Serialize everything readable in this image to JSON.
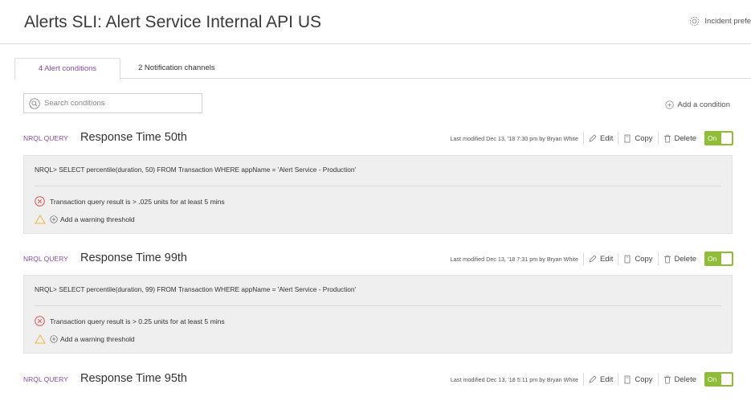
{
  "page": {
    "title": "Alerts SLI: Alert Service Internal API US",
    "incident_prefs": "Incident prefe"
  },
  "tabs": [
    {
      "label": "4 Alert conditions",
      "active": true
    },
    {
      "label": "2 Notification channels",
      "active": false
    }
  ],
  "search": {
    "placeholder": "Search conditions"
  },
  "add_condition": "Add a condition",
  "colors": {
    "accent": "#8a4b9f",
    "toggle_on": "#8fbd36",
    "critical": "#e05252",
    "warning": "#f0b43c"
  },
  "conditions": [
    {
      "tag": "NRQL QUERY",
      "name": "Response Time 50th",
      "modified": "Last modified Dec 13, '18 7:30 pm by Bryan White",
      "edit": "Edit",
      "copy": "Copy",
      "delete": "Delete",
      "toggle": "On",
      "query": "NRQL> SELECT percentile(duration, 50) FROM Transaction WHERE appName = 'Alert Service - Production'",
      "critical": "Transaction query result is > .025 units for at least 5 mins",
      "warning_link": "Add a warning threshold"
    },
    {
      "tag": "NRQL QUERY",
      "name": "Response Time 99th",
      "modified": "Last modified Dec 13, '18 7:31 pm by Bryan White",
      "edit": "Edit",
      "copy": "Copy",
      "delete": "Delete",
      "toggle": "On",
      "query": "NRQL> SELECT percentile(duration, 99) FROM Transaction WHERE appName = 'Alert Service - Production'",
      "critical": "Transaction query result is > 0.25 units for at least 5 mins",
      "warning_link": "Add a warning threshold"
    },
    {
      "tag": "NRQL QUERY",
      "name": "Response Time 95th",
      "modified": "Last modified Dec 13, '18 5:11 pm by Bryan White",
      "edit": "Edit",
      "copy": "Copy",
      "delete": "Delete",
      "toggle": "On"
    }
  ]
}
